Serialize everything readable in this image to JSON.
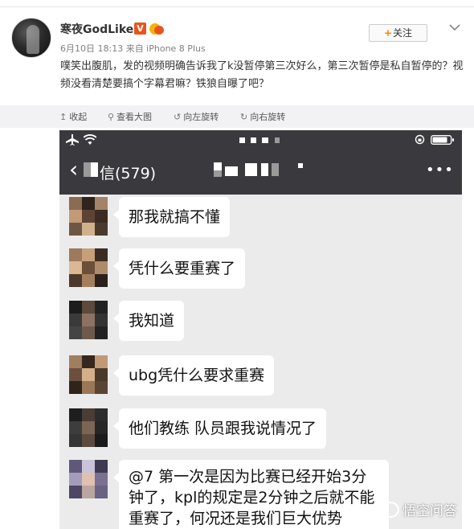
{
  "post": {
    "username": "寒夜GodLike",
    "verified_badge": "V",
    "meta": "6月10日 18:13 来自 iPhone 8 Plus",
    "follow_label": "关注",
    "follow_plus": "+",
    "text": "噗笑出腹肌，发的视频明确告诉我了k没暂停第三次好么，第三次暂停是私自暂停的？视频没看清楚要搞个字幕君嘛？铁狼自曝了吧？",
    "colors": {
      "accent": "#ff8200",
      "verified": "#e8541e"
    }
  },
  "toolbar": {
    "items": [
      {
        "icon": "collapse-icon",
        "glyph": "↥",
        "label": "收起"
      },
      {
        "icon": "zoom-icon",
        "glyph": "⚲",
        "label": "查看大图"
      },
      {
        "icon": "rotate-left-icon",
        "glyph": "↺",
        "label": "向左旋转"
      },
      {
        "icon": "rotate-right-icon",
        "glyph": "↻",
        "label": "向右旋转"
      }
    ]
  },
  "screenshot": {
    "status_icons": [
      "airplane-icon",
      "wifi-icon",
      "lock-rotation-icon",
      "battery-icon"
    ],
    "chat_title": "信(579)",
    "back_glyph": "‹",
    "more_glyph": "•••",
    "messages": [
      {
        "text": "那我就搞不懂"
      },
      {
        "text": "凭什么要重赛了"
      },
      {
        "text": "我知道"
      },
      {
        "text": "ubg凭什么要求重赛"
      },
      {
        "text": "他们教练 队员跟我说情况了"
      },
      {
        "text": "@7 第一次是因为比赛已经开始3分钟了，kpl的规定是2分钟之后就不能重赛了，何况还是我们巨大优势"
      }
    ]
  },
  "watermark": {
    "text": "悟空问答"
  }
}
